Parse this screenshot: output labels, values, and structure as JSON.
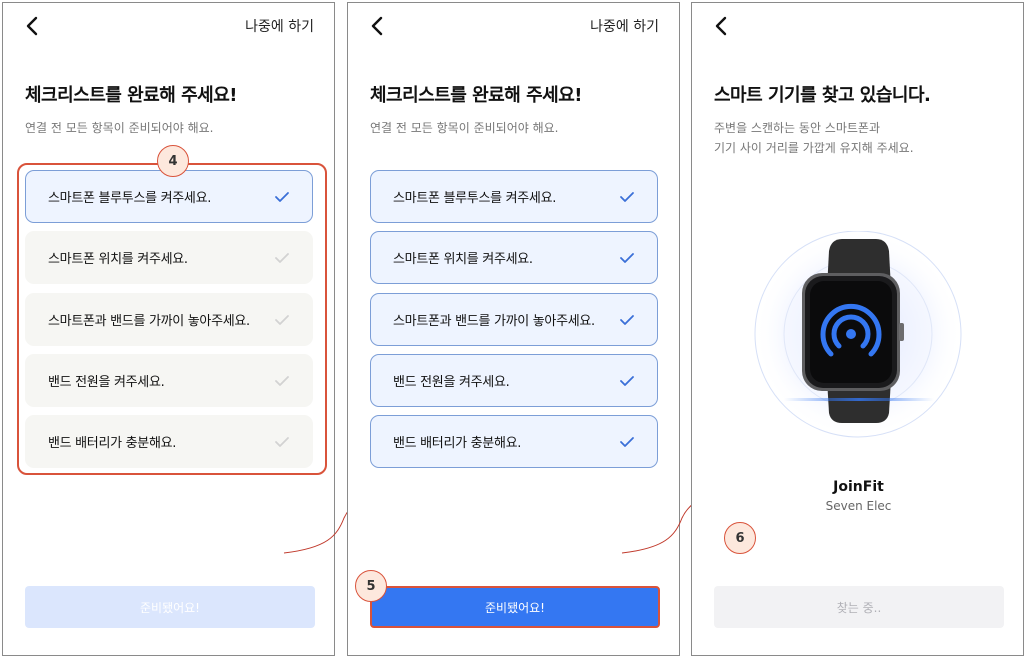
{
  "screens": [
    {
      "later_label": "나중에 하기",
      "title": "체크리스트를 완료해 주세요!",
      "subtitle": "연결 전 모든 항목이 준비되어야 해요.",
      "items": [
        {
          "label": "스마트폰 블루투스를 켜주세요.",
          "checked": true
        },
        {
          "label": "스마트폰 위치를 켜주세요.",
          "checked": false
        },
        {
          "label": "스마트폰과 밴드를 가까이 놓아주세요.",
          "checked": false
        },
        {
          "label": "밴드 전원을 켜주세요.",
          "checked": false
        },
        {
          "label": "밴드 배터리가 충분해요.",
          "checked": false
        }
      ],
      "badge": "4",
      "button_label": "준비됐어요!"
    },
    {
      "later_label": "나중에 하기",
      "title": "체크리스트를 완료해 주세요!",
      "subtitle": "연결 전 모든 항목이 준비되어야 해요.",
      "items": [
        {
          "label": "스마트폰 블루투스를 켜주세요.",
          "checked": true
        },
        {
          "label": "스마트폰 위치를 켜주세요.",
          "checked": true
        },
        {
          "label": "스마트폰과 밴드를 가까이 놓아주세요.",
          "checked": true
        },
        {
          "label": "밴드 전원을 켜주세요.",
          "checked": true
        },
        {
          "label": "밴드 배터리가 충분해요.",
          "checked": true
        }
      ],
      "badge": "5",
      "button_label": "준비됐어요!"
    },
    {
      "title": "스마트 기기를 찾고 있습니다.",
      "subtitle_line1": "주변을 스캔하는 동안 스마트폰과",
      "subtitle_line2": "기기 사이 거리를 가깝게 유지해 주세요.",
      "device_name": "JoinFit",
      "device_maker": "Seven Elec",
      "badge": "6",
      "button_label": "찾는 중.."
    }
  ],
  "colors": {
    "primary": "#3477f2",
    "primary_disabled": "#dbe6fd",
    "highlight": "#d9533b",
    "badge_bg": "#fde8dd",
    "active_item_bg": "#eef4ff",
    "active_item_border": "#7c9ed7",
    "inactive_item_bg": "#f6f6f3"
  },
  "icons": [
    "chevron-left-icon",
    "check-icon",
    "broadcast-icon",
    "smartwatch-icon"
  ]
}
